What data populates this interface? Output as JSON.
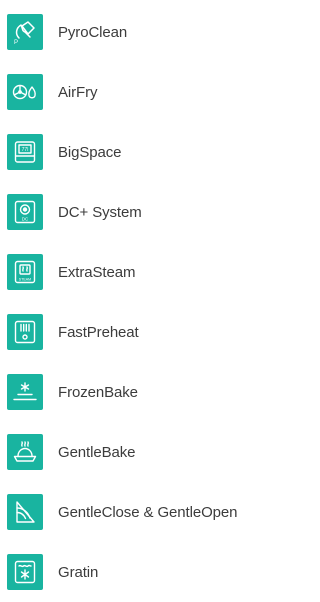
{
  "colors": {
    "icon_background": "#19b4a0",
    "icon_foreground": "#ffffff",
    "label_text": "#3c3c3c"
  },
  "features": [
    {
      "icon": "pyroclean-icon",
      "label": "PyroClean"
    },
    {
      "icon": "airfry-icon",
      "label": "AirFry"
    },
    {
      "icon": "bigspace-icon",
      "label": "BigSpace",
      "icon_text": "77l"
    },
    {
      "icon": "dc-system-icon",
      "label": "DC+ System",
      "icon_text": "DC"
    },
    {
      "icon": "extrasteam-icon",
      "label": "ExtraSteam",
      "icon_text": "STEAM"
    },
    {
      "icon": "fastpreheat-icon",
      "label": "FastPreheat"
    },
    {
      "icon": "frozenbake-icon",
      "label": "FrozenBake"
    },
    {
      "icon": "gentlebake-icon",
      "label": "GentleBake"
    },
    {
      "icon": "gentleclose-gentleopen-icon",
      "label": "GentleClose & GentleOpen"
    },
    {
      "icon": "gratin-icon",
      "label": "Gratin"
    }
  ]
}
